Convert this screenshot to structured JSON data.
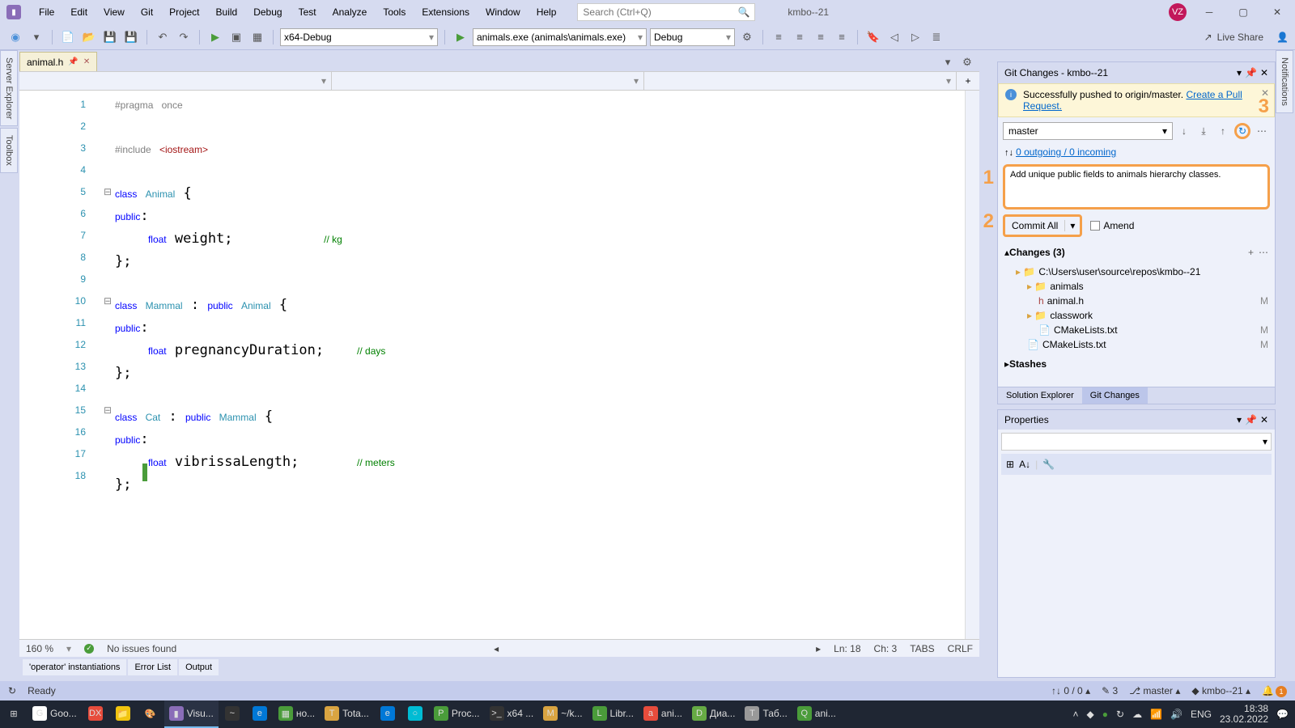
{
  "menu": [
    "File",
    "Edit",
    "View",
    "Git",
    "Project",
    "Build",
    "Debug",
    "Test",
    "Analyze",
    "Tools",
    "Extensions",
    "Window",
    "Help"
  ],
  "search_placeholder": "Search (Ctrl+Q)",
  "project_name": "kmbo--21",
  "avatar": "VZ",
  "toolbar": {
    "config": "x64-Debug",
    "target": "animals.exe (animals\\animals.exe)",
    "debug": "Debug",
    "liveshare": "Live Share"
  },
  "vtabs_left": [
    "Server Explorer",
    "Toolbox"
  ],
  "vtab_right": "Notifications",
  "filetab": "animal.h",
  "code_lines": [
    {
      "n": 1,
      "fold": "",
      "html": "<span class='kw-pp'>#pragma</span> <span class='kw-pp'>once</span>"
    },
    {
      "n": 2,
      "fold": "",
      "html": ""
    },
    {
      "n": 3,
      "fold": "",
      "html": "<span class='kw-pp'>#include</span> <span class='str-inc'>&lt;iostream&gt;</span>"
    },
    {
      "n": 4,
      "fold": "",
      "html": ""
    },
    {
      "n": 5,
      "fold": "⊟",
      "html": "<span class='kw-blue'>class</span> <span class='kw-type'>Animal</span> {"
    },
    {
      "n": 6,
      "fold": "",
      "html": "<span class='kw-blue'>public</span>:"
    },
    {
      "n": 7,
      "fold": "",
      "html": "    <span class='kw-blue'>float</span> weight;           <span class='comment'>// kg</span>"
    },
    {
      "n": 8,
      "fold": "",
      "html": "};"
    },
    {
      "n": 9,
      "fold": "",
      "html": ""
    },
    {
      "n": 10,
      "fold": "⊟",
      "html": "<span class='kw-blue'>class</span> <span class='kw-type'>Mammal</span> : <span class='kw-blue'>public</span> <span class='kw-type'>Animal</span> {"
    },
    {
      "n": 11,
      "fold": "",
      "html": "<span class='kw-blue'>public</span>:"
    },
    {
      "n": 12,
      "fold": "",
      "html": "    <span class='kw-blue'>float</span> pregnancyDuration;    <span class='comment'>// days</span>"
    },
    {
      "n": 13,
      "fold": "",
      "html": "};"
    },
    {
      "n": 14,
      "fold": "",
      "html": ""
    },
    {
      "n": 15,
      "fold": "⊟",
      "html": "<span class='kw-blue'>class</span> <span class='kw-type'>Cat</span> : <span class='kw-blue'>public</span> <span class='kw-type'>Mammal</span> {"
    },
    {
      "n": 16,
      "fold": "",
      "html": "<span class='kw-blue'>public</span>:"
    },
    {
      "n": 17,
      "fold": "",
      "html": "    <span class='kw-blue'>float</span> vibrissaLength;       <span class='comment'>// meters</span>"
    },
    {
      "n": 18,
      "fold": "",
      "html": "};"
    }
  ],
  "ed_status": {
    "zoom": "160 %",
    "issues": "No issues found",
    "ln": "Ln: 18",
    "ch": "Ch: 3",
    "tabs": "TABS",
    "crlf": "CRLF"
  },
  "output_tabs": [
    "'operator' instantiations",
    "Error List",
    "Output"
  ],
  "statusbar": {
    "ready": "Ready",
    "pull": "0 / 0",
    "pencil": "3",
    "branch": "master",
    "repo": "kmbo--21",
    "notif": "1"
  },
  "git": {
    "title": "Git Changes - kmbo--21",
    "info_text": "Successfully pushed to origin/master. ",
    "info_link": "Create a Pull Request.",
    "branch": "master",
    "pending": "0 outgoing / 0 incoming",
    "commit_msg": "Add unique public fields to animals hierarchy classes.",
    "commit_btn": "Commit All",
    "amend": "Amend",
    "changes_hdr": "Changes (3)",
    "tree": [
      {
        "lvl": 1,
        "ico": "folder",
        "text": "C:\\Users\\user\\source\\repos\\kmbo--21",
        "m": ""
      },
      {
        "lvl": 2,
        "ico": "folder",
        "text": "animals",
        "m": ""
      },
      {
        "lvl": 3,
        "ico": "cpp",
        "text": "animal.h",
        "m": "M"
      },
      {
        "lvl": 2,
        "ico": "folder",
        "text": "classwork",
        "m": ""
      },
      {
        "lvl": 3,
        "ico": "file",
        "text": "CMakeLists.txt",
        "m": "M"
      },
      {
        "lvl": 2,
        "ico": "file",
        "text": "CMakeLists.txt",
        "m": "M"
      }
    ],
    "stashes": "Stashes",
    "bottom_tabs": [
      "Solution Explorer",
      "Git Changes"
    ]
  },
  "props_title": "Properties",
  "step_nums": {
    "1": "1",
    "2": "2",
    "3": "3"
  },
  "taskbar": [
    {
      "ico": "⊞",
      "bg": "",
      "txt": ""
    },
    {
      "ico": "G",
      "bg": "#fff",
      "txt": "Goo..."
    },
    {
      "ico": "DX",
      "bg": "#e74c3c",
      "txt": ""
    },
    {
      "ico": "📁",
      "bg": "#f1c40f",
      "txt": ""
    },
    {
      "ico": "🎨",
      "bg": "",
      "txt": ""
    },
    {
      "ico": "▮",
      "bg": "#8a6db8",
      "txt": "Visu..."
    },
    {
      "ico": "~",
      "bg": "#333",
      "txt": ""
    },
    {
      "ico": "e",
      "bg": "#0078d7",
      "txt": ""
    },
    {
      "ico": "▦",
      "bg": "#4a9c3a",
      "txt": "но..."
    },
    {
      "ico": "T",
      "bg": "#d9a441",
      "txt": "Tota..."
    },
    {
      "ico": "e",
      "bg": "#0078d7",
      "txt": ""
    },
    {
      "ico": "○",
      "bg": "#00bcd4",
      "txt": ""
    },
    {
      "ico": "P",
      "bg": "#4a9c3a",
      "txt": "Proc..."
    },
    {
      "ico": ">_",
      "bg": "#333",
      "txt": "x64 ..."
    },
    {
      "ico": "M",
      "bg": "#d9a441",
      "txt": "~/k..."
    },
    {
      "ico": "L",
      "bg": "#4a9c3a",
      "txt": "Libr..."
    },
    {
      "ico": "a",
      "bg": "#e74c3c",
      "txt": "ani..."
    },
    {
      "ico": "D",
      "bg": "#6a4",
      "txt": "Диа..."
    },
    {
      "ico": "T",
      "bg": "#999",
      "txt": "Таб..."
    },
    {
      "ico": "Q",
      "bg": "#4a9c3a",
      "txt": "ani..."
    }
  ],
  "tray": {
    "lang": "ENG",
    "time": "18:38",
    "date": "23.02.2022"
  }
}
